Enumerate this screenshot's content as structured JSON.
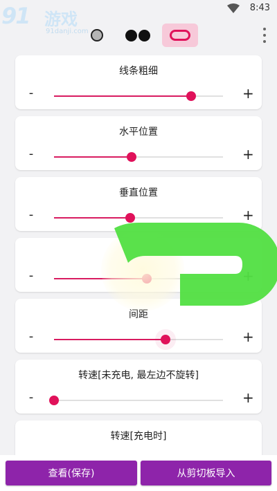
{
  "status_bar": {
    "time": "8:43"
  },
  "watermark": {
    "logo": "91",
    "title": "游戏",
    "url": "91danji.com"
  },
  "toolbar": {
    "shapes": [
      "single-dot",
      "double-dot",
      "pill"
    ],
    "selected_shape": "pill",
    "accent_color": "#e0115a",
    "selected_bg": "#f7c9d9"
  },
  "sliders": [
    {
      "label": "线条粗细",
      "value": 0.81
    },
    {
      "label": "水平位置",
      "value": 0.46
    },
    {
      "label": "垂直位置",
      "value": 0.45
    },
    {
      "label": "",
      "value": 0.55
    },
    {
      "label": "间距",
      "value": 0.66
    },
    {
      "label": "转速[未充电, 最左边不旋转]",
      "value": 0.0
    },
    {
      "label": "转速[充电时]",
      "value": null
    }
  ],
  "slider_controls": {
    "minus": "-",
    "plus": "+"
  },
  "bottom": {
    "view_save": "查看(保存)",
    "import_clipboard": "从剪切板导入"
  },
  "colors": {
    "button_bg": "#8e24aa",
    "slider_fill": "#d81b60",
    "overlay_green": "#52e043"
  }
}
